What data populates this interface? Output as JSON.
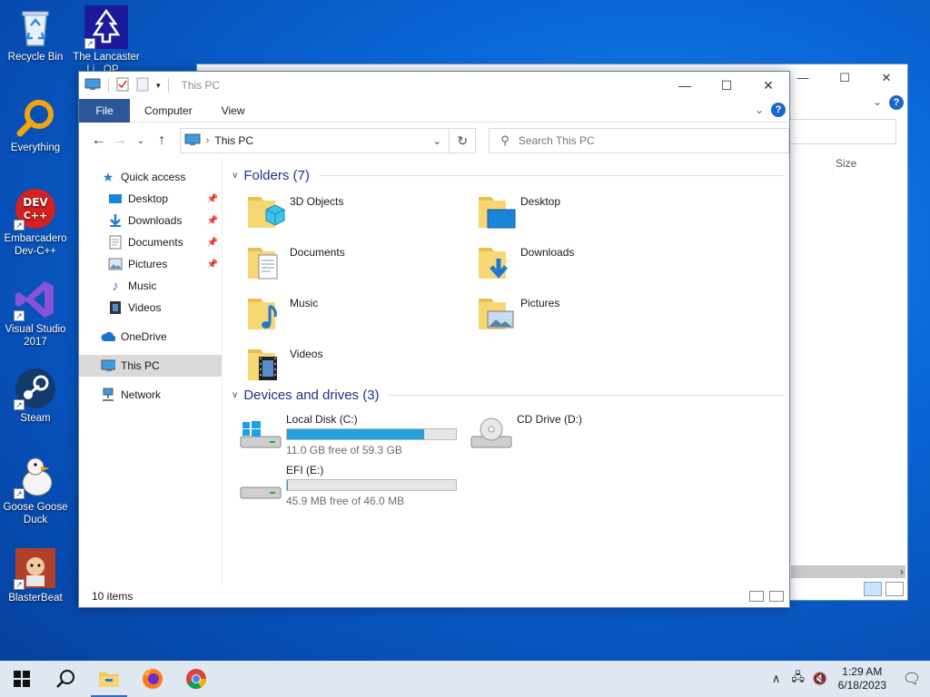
{
  "desktop": {
    "icons": [
      {
        "label": "Recycle Bin"
      },
      {
        "label": "The Lancaster Li..."
      },
      {
        "label": "Everything"
      },
      {
        "label": "Embarcadero Dev-C++"
      },
      {
        "label": "Visual Studio 2017"
      },
      {
        "label": "Steam"
      },
      {
        "label": "Goose Goose Duck"
      },
      {
        "label": "BlasterBeat"
      }
    ],
    "icon_lines": {
      "lancaster": [
        "The Lancaster",
        "Li...OP..."
      ],
      "devcpp": [
        "Embarcadero",
        "Dev-C++"
      ],
      "vs": [
        "Visual Studio",
        "2017"
      ],
      "goose": [
        "Goose Goose",
        "Duck"
      ]
    },
    "devcpp_badge": [
      "DEV",
      "C++"
    ]
  },
  "back_window": {
    "column_size": "Size"
  },
  "window": {
    "title": "This PC",
    "controls": {
      "minimize": "—",
      "maximize": "☐",
      "close": "✕"
    },
    "ribbon_tabs": [
      "File",
      "Computer",
      "View"
    ],
    "help": "?",
    "address": {
      "location": "This PC"
    },
    "search_placeholder": "Search This PC",
    "nav_pane": {
      "quick_access": "Quick access",
      "pinned": [
        "Desktop",
        "Downloads",
        "Documents",
        "Pictures"
      ],
      "unpinned": [
        "Music",
        "Videos"
      ],
      "onedrive": "OneDrive",
      "this_pc": "This PC",
      "network": "Network"
    },
    "folders_header": "Folders (7)",
    "folders": [
      "3D Objects",
      "Desktop",
      "Documents",
      "Downloads",
      "Music",
      "Pictures",
      "Videos"
    ],
    "drives_header": "Devices and drives (3)",
    "drives": [
      {
        "name": "Local Disk (C:)",
        "free": "11.0 GB free of 59.3 GB",
        "used_fraction": 0.81
      },
      {
        "name": "CD Drive (D:)"
      },
      {
        "name": "EFI (E:)",
        "free": "45.9 MB free of 46.0 MB",
        "used_fraction": 0.003
      }
    ],
    "status": "10 items"
  },
  "taskbar": {
    "time": "1:29 AM",
    "date": "6/18/2023"
  },
  "colors": {
    "accent": "#2b579a",
    "drive_bar": "#26a0da",
    "section_header": "#1e3287"
  }
}
